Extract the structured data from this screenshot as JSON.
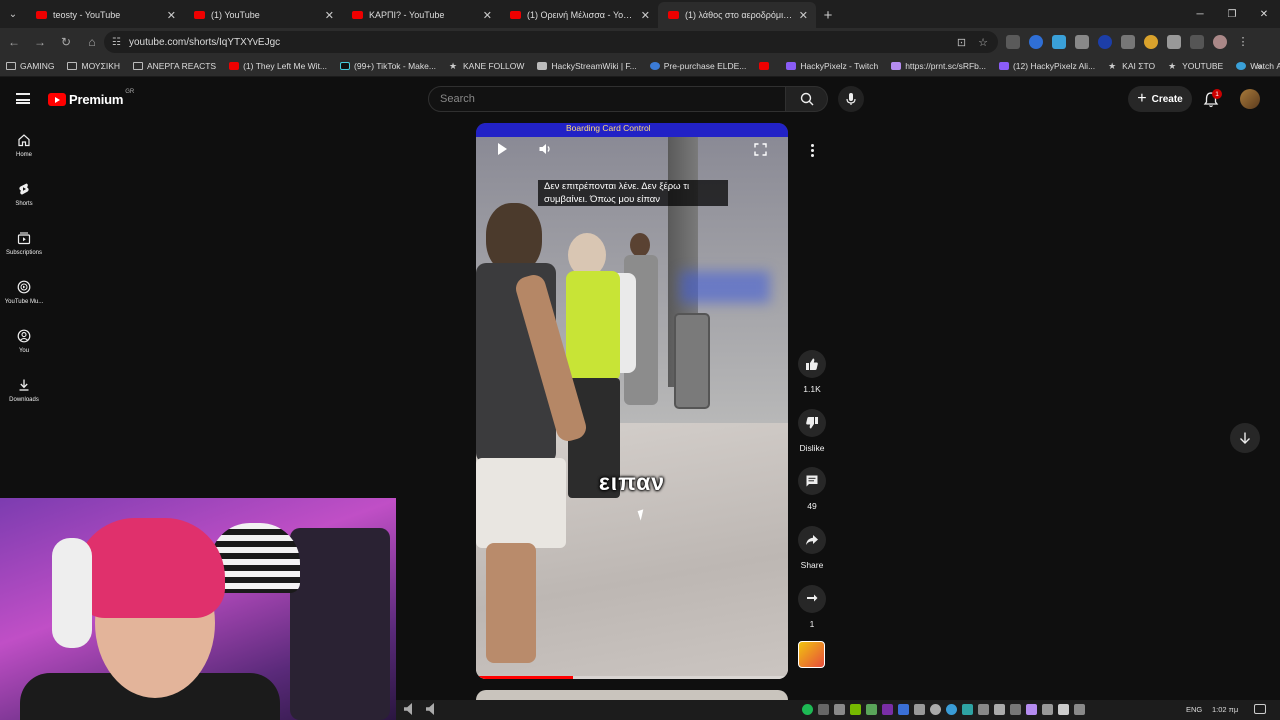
{
  "browser": {
    "tabs": [
      {
        "title": "teosty - YouTube",
        "active": false
      },
      {
        "title": "(1) YouTube",
        "active": false
      },
      {
        "title": "ΚΑΡΠΙ? - YouTube",
        "active": false
      },
      {
        "title": "(1) Ορεινή Μέλισσα - YouTube",
        "active": false
      },
      {
        "title": "(1) λάθος στο αεροδρόμιο - YouTube",
        "active": true
      }
    ],
    "url": "youtube.com/shorts/IqYTXYvEJgc",
    "bookmarks": [
      {
        "label": "GAMING",
        "type": "folder"
      },
      {
        "label": "ΜΟΥΣΙΚΗ",
        "type": "folder"
      },
      {
        "label": "ΑΝΕΡΓΑ REACTS",
        "type": "folder"
      },
      {
        "label": "(1) They Left Me Wit...",
        "type": "youtube"
      },
      {
        "label": "(99+) TikTok - Make...",
        "type": "tiktok"
      },
      {
        "label": "KANE FOLLOW",
        "type": "star"
      },
      {
        "label": "HackyStreamWiki | F...",
        "type": "doc"
      },
      {
        "label": "Pre-purchase ELDE...",
        "type": "steam"
      },
      {
        "label": "",
        "type": "youtube"
      },
      {
        "label": "HackyPixelz - Twitch",
        "type": "twitch"
      },
      {
        "label": "https://prnt.sc/sRFb...",
        "type": "feather"
      },
      {
        "label": "(12) HackyPixelz Ali...",
        "type": "twitch"
      },
      {
        "label": "ΚΑΙ ΣΤΟ",
        "type": "star"
      },
      {
        "label": "YOUTUBE",
        "type": "star"
      },
      {
        "label": "Watch Ανεργο Intro...",
        "type": "globe"
      }
    ]
  },
  "youtube": {
    "logo_text": "Premium",
    "region": "GR",
    "search_placeholder": "Search",
    "create_label": "Create",
    "notification_count": "1",
    "sidebar": [
      {
        "label": "Home",
        "icon": "home-icon"
      },
      {
        "label": "Shorts",
        "icon": "shorts-icon"
      },
      {
        "label": "Subscriptions",
        "icon": "subscriptions-icon"
      },
      {
        "label": "YouTube Mu...",
        "icon": "youtube-music-icon"
      },
      {
        "label": "You",
        "icon": "you-icon"
      },
      {
        "label": "Downloads",
        "icon": "downloads-icon"
      }
    ]
  },
  "short": {
    "banner_text": "Boarding Card Control",
    "caption_top": "Δεν επιτρέπονται λένε. Δεν ξέρω τι συμβαίνει. Όπως μου είπαν",
    "caption_big": "ειπαν",
    "progress": 0.31,
    "like_count": "1.1K",
    "dislike_label": "Dislike",
    "comment_count": "49",
    "share_label": "Share",
    "remix_count": "1"
  },
  "taskbar": {
    "lang": "ENG",
    "time": "1:02 πμ"
  },
  "colors": {
    "yt_red": "#ff0000",
    "bg": "#0f0f0f",
    "surface": "#272727"
  }
}
